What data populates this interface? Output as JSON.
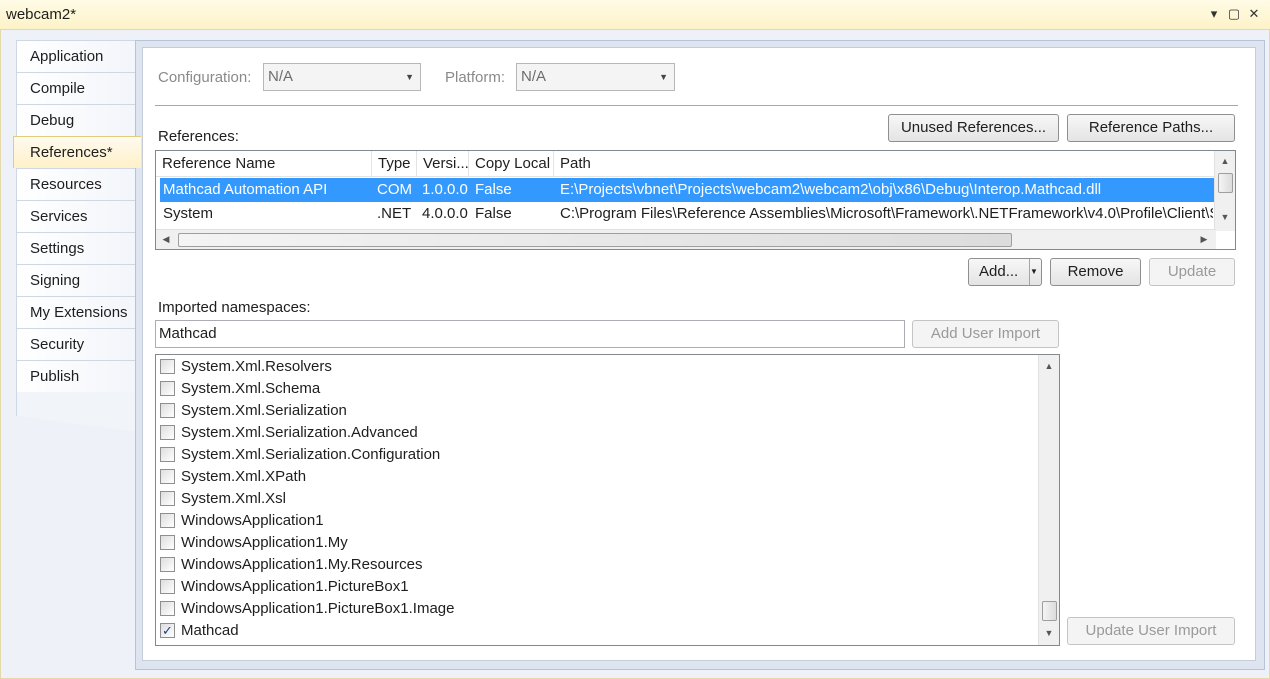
{
  "window": {
    "title": "webcam2*",
    "controls": {
      "dropdown": "▾",
      "maximize": "▢",
      "close": "✕"
    }
  },
  "sidebar": {
    "items": [
      {
        "label": "Application"
      },
      {
        "label": "Compile"
      },
      {
        "label": "Debug"
      },
      {
        "label": "References*",
        "active": true
      },
      {
        "label": "Resources"
      },
      {
        "label": "Services"
      },
      {
        "label": "Settings"
      },
      {
        "label": "Signing"
      },
      {
        "label": "My Extensions"
      },
      {
        "label": "Security"
      },
      {
        "label": "Publish"
      }
    ]
  },
  "config": {
    "configuration_label": "Configuration:",
    "configuration_value": "N/A",
    "platform_label": "Platform:",
    "platform_value": "N/A"
  },
  "references": {
    "label": "References:",
    "unused_button": "Unused References...",
    "paths_button": "Reference Paths...",
    "columns": [
      "Reference Name",
      "Type",
      "Versi...",
      "Copy Local",
      "Path"
    ],
    "rows": [
      {
        "name": "Mathcad Automation API",
        "type": "COM",
        "version": "1.0.0.0",
        "copy_local": "False",
        "path": "E:\\Projects\\vbnet\\Projects\\webcam2\\webcam2\\obj\\x86\\Debug\\Interop.Mathcad.dll",
        "selected": true
      },
      {
        "name": "System",
        "type": ".NET",
        "version": "4.0.0.0",
        "copy_local": "False",
        "path": "C:\\Program Files\\Reference Assemblies\\Microsoft\\Framework\\.NETFramework\\v4.0\\Profile\\Client\\S",
        "selected": false
      }
    ],
    "add_button": "Add...",
    "remove_button": "Remove",
    "update_button": "Update"
  },
  "imports": {
    "label": "Imported namespaces:",
    "input_value": "Mathcad",
    "add_user_import_button": "Add User Import",
    "update_user_import_button": "Update User Import",
    "items": [
      {
        "label": "System.Xml.Resolvers",
        "checked": false
      },
      {
        "label": "System.Xml.Schema",
        "checked": false
      },
      {
        "label": "System.Xml.Serialization",
        "checked": false
      },
      {
        "label": "System.Xml.Serialization.Advanced",
        "checked": false
      },
      {
        "label": "System.Xml.Serialization.Configuration",
        "checked": false
      },
      {
        "label": "System.Xml.XPath",
        "checked": false
      },
      {
        "label": "System.Xml.Xsl",
        "checked": false
      },
      {
        "label": "WindowsApplication1",
        "checked": false
      },
      {
        "label": "WindowsApplication1.My",
        "checked": false
      },
      {
        "label": "WindowsApplication1.My.Resources",
        "checked": false
      },
      {
        "label": "WindowsApplication1.PictureBox1",
        "checked": false
      },
      {
        "label": "WindowsApplication1.PictureBox1.Image",
        "checked": false
      },
      {
        "label": "Mathcad",
        "checked": true
      }
    ]
  }
}
